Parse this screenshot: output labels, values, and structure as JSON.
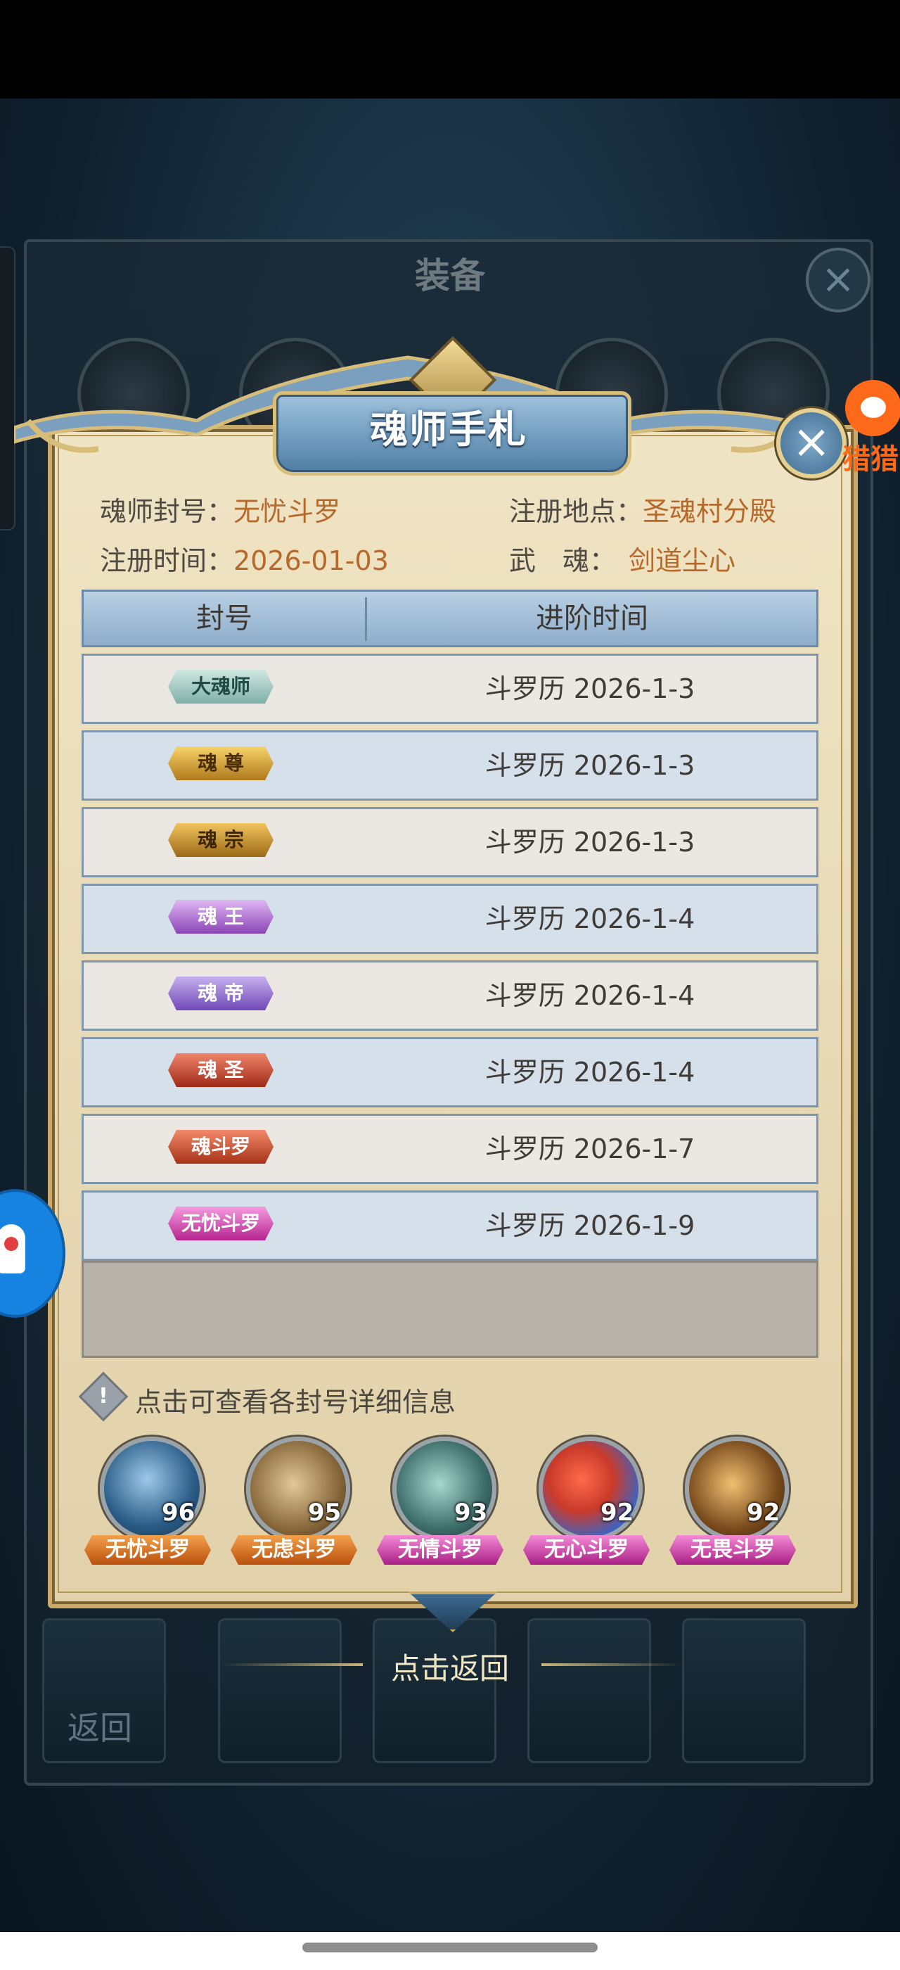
{
  "background": {
    "panel_title": "装备",
    "back_label": "返回"
  },
  "dialog": {
    "title": "魂师手札",
    "close_symbol": "×",
    "info": {
      "title_key": "魂师封号：",
      "title_value": "无忧斗罗",
      "location_key": "注册地点：",
      "location_value": "圣魂村分殿",
      "date_key": "注册时间：",
      "date_value": "2026-01-03",
      "soul_key": "武　魂：",
      "soul_value": "剑道尘心"
    },
    "table": {
      "headers": [
        "封号",
        "进阶时间"
      ],
      "rows": [
        {
          "badge": "大魂师",
          "date": "斗罗历 2026-1-3",
          "color": "#3b6e6a"
        },
        {
          "badge": "魂 尊",
          "date": "斗罗历 2026-1-3",
          "color": "#6b4a12"
        },
        {
          "badge": "魂 宗",
          "date": "斗罗历 2026-1-3",
          "color": "#5c3d14"
        },
        {
          "badge": "魂 王",
          "date": "斗罗历 2026-1-4",
          "color": "#6a2f87"
        },
        {
          "badge": "魂 帝",
          "date": "斗罗历 2026-1-4",
          "color": "#5a3090"
        },
        {
          "badge": "魂 圣",
          "date": "斗罗历 2026-1-4",
          "color": "#7a2418"
        },
        {
          "badge": "魂斗罗",
          "date": "斗罗历 2026-1-7",
          "color": "#8a2a18"
        },
        {
          "badge": "无忧斗罗",
          "date": "斗罗历 2026-1-9",
          "color": "#a4208e"
        }
      ]
    },
    "hint": "点击可查看各封号详细信息",
    "avatars": [
      {
        "level": "96",
        "name": "无忧斗罗",
        "badge_color": "#c55a12",
        "bg": "#3c6f99"
      },
      {
        "level": "95",
        "name": "无虑斗罗",
        "badge_color": "#c55a12",
        "bg": "#8a6a3c"
      },
      {
        "level": "93",
        "name": "无情斗罗",
        "badge_color": "#b5248f",
        "bg": "#3e6e6a"
      },
      {
        "level": "92",
        "name": "无心斗罗",
        "badge_color": "#b5248f",
        "bg": "#b0452c"
      },
      {
        "level": "92",
        "name": "无畏斗罗",
        "badge_color": "#b5248f",
        "bg": "#7a4c1e"
      }
    ]
  },
  "footer": {
    "return_label": "点击返回"
  },
  "overlay": {
    "corner_logo_text": "猎猎"
  }
}
